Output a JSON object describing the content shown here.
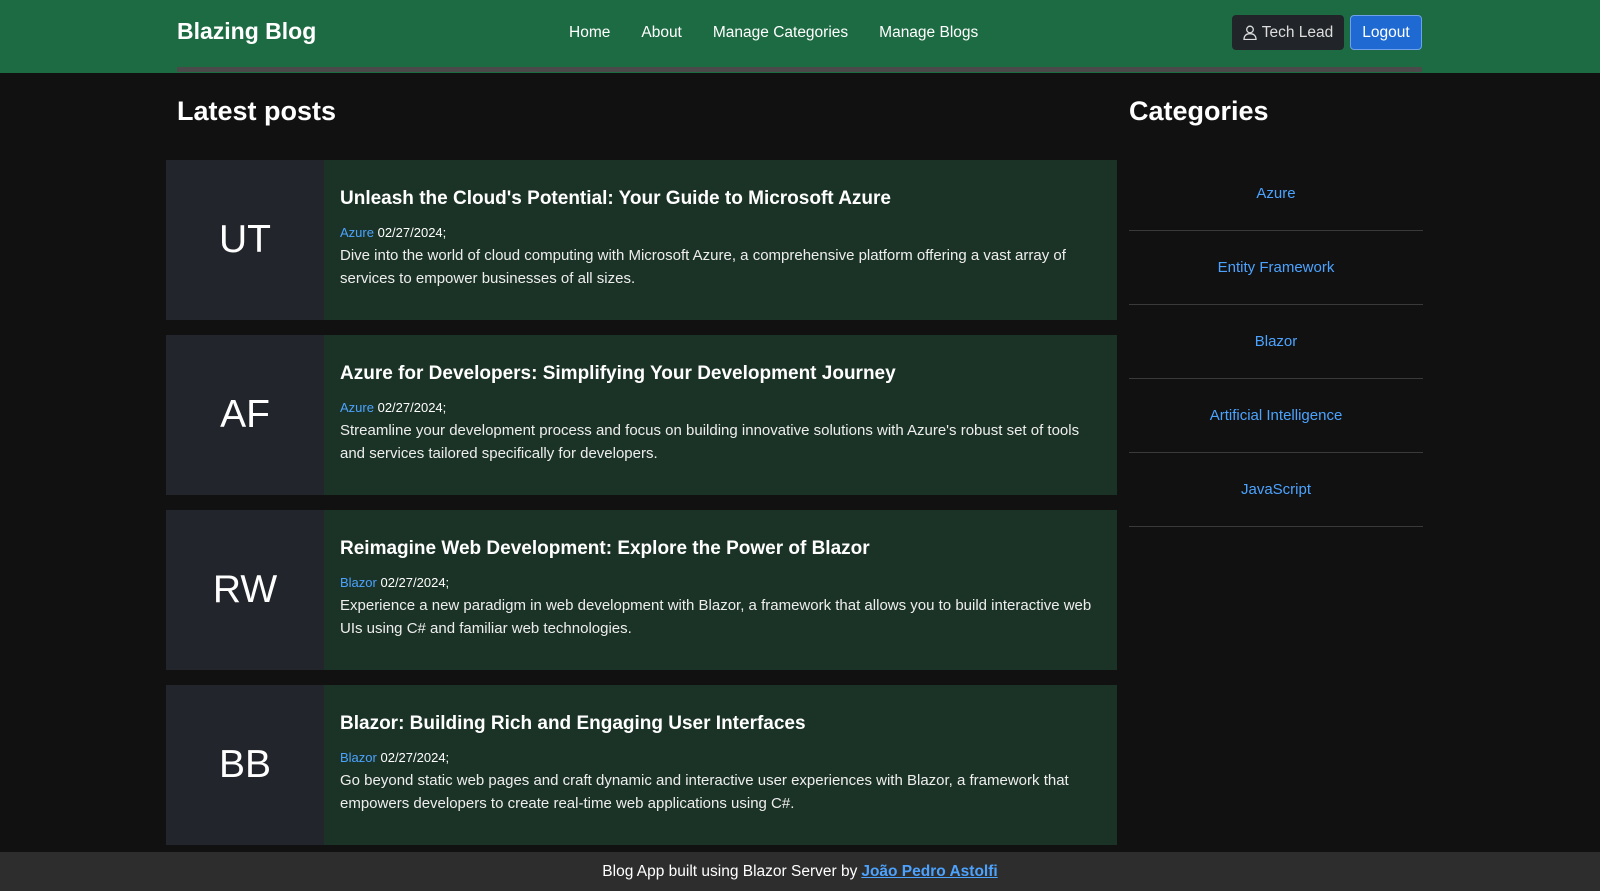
{
  "navbar": {
    "brand": "Blazing Blog",
    "links": [
      "Home",
      "About",
      "Manage Categories",
      "Manage Blogs"
    ],
    "user_name": "Tech Lead",
    "logout_label": "Logout"
  },
  "main": {
    "title": "Latest posts",
    "posts": [
      {
        "initials": "UT",
        "title": "Unleash the Cloud's Potential: Your Guide to Microsoft Azure",
        "category": "Azure",
        "date": "02/27/2024;",
        "description": "Dive into the world of cloud computing with Microsoft Azure, a comprehensive platform offering a vast array of services to empower businesses of all sizes."
      },
      {
        "initials": "AF",
        "title": "Azure for Developers: Simplifying Your Development Journey",
        "category": "Azure",
        "date": "02/27/2024;",
        "description": "Streamline your development process and focus on building innovative solutions with Azure's robust set of tools and services tailored specifically for developers."
      },
      {
        "initials": "RW",
        "title": "Reimagine Web Development: Explore the Power of Blazor",
        "category": "Blazor",
        "date": "02/27/2024;",
        "description": "Experience a new paradigm in web development with Blazor, a framework that allows you to build interactive web UIs using C# and familiar web technologies."
      },
      {
        "initials": "BB",
        "title": "Blazor: Building Rich and Engaging User Interfaces",
        "category": "Blazor",
        "date": "02/27/2024;",
        "description": "Go beyond static web pages and craft dynamic and interactive user experiences with Blazor, a framework that empowers developers to create real-time web applications using C#."
      }
    ]
  },
  "sidebar": {
    "title": "Categories",
    "categories": [
      "Azure",
      "Entity Framework",
      "Blazor",
      "Artificial Intelligence",
      "JavaScript"
    ]
  },
  "footer": {
    "text": "Blog App built using Blazor Server by",
    "author": "João Pedro Astolfi"
  },
  "colors": {
    "navbar": "#1d6b43",
    "link": "#4ca3ff",
    "logout_button": "#1f6ad2"
  }
}
